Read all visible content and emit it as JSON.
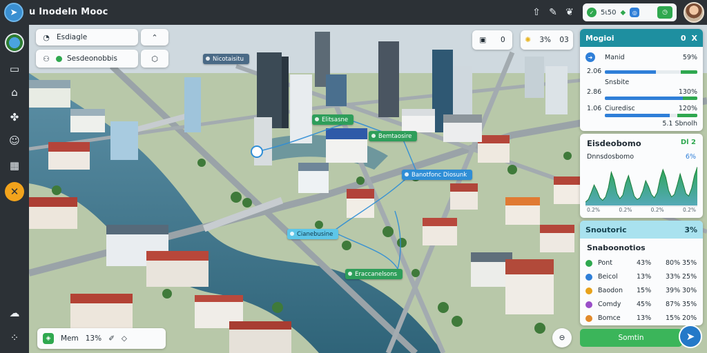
{
  "app": {
    "title": "Inodeln Mooc",
    "title_prefix": "u"
  },
  "topbar": {
    "pill_text": "5ι50",
    "icons": [
      "tree-icon",
      "pen-icon",
      "leaf-icon"
    ],
    "pill_badge": "◎",
    "pill_square": "◷"
  },
  "sidebar": {
    "items": [
      "globe-icon",
      "book-icon",
      "home-icon",
      "puzzle-icon",
      "smile-icon",
      "grid-icon",
      "tools-icon",
      "weather-icon",
      "network-icon"
    ]
  },
  "search_panel": {
    "row1_label": "Esdiagle",
    "row2_label": "Sesdeonobbis"
  },
  "view_controls": {
    "box1_icon": "▣",
    "box1_value": "0",
    "box2_value": "3%",
    "box2_extra": "03"
  },
  "map_tags": [
    {
      "label": "Elitsasne",
      "style": "green"
    },
    {
      "label": "Bemtaosire",
      "style": "green"
    },
    {
      "label": "Banotfonc Diosunk",
      "style": "blue"
    },
    {
      "label": "Cianebusine",
      "style": "cyan"
    },
    {
      "label": "Eraccanelsons",
      "style": "green"
    },
    {
      "label": "Nicotaisitu",
      "style": "slate"
    }
  ],
  "metrics_panel": {
    "title": "Mogioi",
    "close": "X",
    "count": "0",
    "rows": [
      {
        "label": "Manid",
        "left": "2.06",
        "value": "59%",
        "blue": 0.55,
        "green": 0.45
      },
      {
        "label": "Snsbite",
        "left": "2.86",
        "value": "130%",
        "blue": 0.9,
        "green": 0.4
      },
      {
        "label": "Ciuredisc",
        "left": "1.06",
        "value": "120%",
        "blue": 0.7,
        "green": 0.55
      }
    ],
    "footer": "5.1 Sbnolh"
  },
  "chart_panel": {
    "title": "Eisdeobomo",
    "title_badge": "Dl 2",
    "subtitle": "Dnnsdosbomo",
    "subtitle_value": "6%",
    "x_labels": [
      "0.2%",
      "0.2%",
      "0.2%",
      "0.2%"
    ]
  },
  "chart_data": {
    "type": "area",
    "title": "Eisdeobomo",
    "x": [
      0,
      1,
      2,
      3,
      4,
      5,
      6,
      7,
      8,
      9,
      10,
      11,
      12,
      13,
      14,
      15,
      16,
      17,
      18,
      19,
      20,
      21,
      22,
      23,
      24,
      25,
      26,
      27,
      28,
      29,
      30,
      31,
      32,
      33,
      34,
      35,
      36,
      37,
      38,
      39
    ],
    "values": [
      8,
      14,
      30,
      48,
      35,
      18,
      12,
      20,
      42,
      78,
      60,
      28,
      16,
      24,
      52,
      70,
      46,
      22,
      14,
      18,
      34,
      58,
      44,
      26,
      18,
      30,
      62,
      84,
      66,
      34,
      20,
      26,
      48,
      74,
      52,
      28,
      22,
      40,
      70,
      90
    ],
    "ylim": [
      0,
      100
    ]
  },
  "stats_panel": {
    "header": "Snoutoric",
    "header_value": "3%",
    "title": "Snaboonotios",
    "items": [
      {
        "label": "Pont",
        "v1": "43%",
        "v2": "80%",
        "v3": "35%",
        "color": "#2fa84f"
      },
      {
        "label": "Beicol",
        "v1": "13%",
        "v2": "33%",
        "v3": "25%",
        "color": "#2f7fd8"
      },
      {
        "label": "Baodon",
        "v1": "15%",
        "v2": "39%",
        "v3": "30%",
        "color": "#e8a21b"
      },
      {
        "label": "Comdy",
        "v1": "45%",
        "v2": "87%",
        "v3": "35%",
        "color": "#9a4fc8"
      },
      {
        "label": "Bomce",
        "v1": "13%",
        "v2": "15%",
        "v3": "20%",
        "color": "#e28a2b"
      }
    ],
    "cta_label": "Somtin"
  },
  "bottom_toolbar": {
    "menu_label": "Mem",
    "zoom": "13%"
  }
}
